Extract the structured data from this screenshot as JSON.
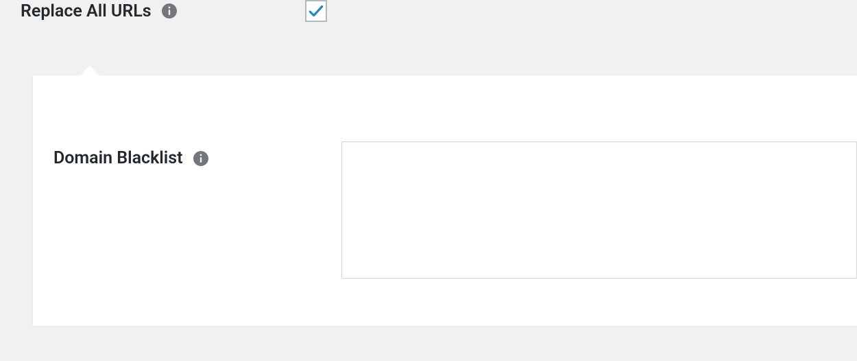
{
  "top": {
    "replace_all_urls_label": "Replace All URLs"
  },
  "panel": {
    "domain_blacklist_label": "Domain Blacklist",
    "domain_blacklist_value": ""
  },
  "icons": {
    "info_name": "info-icon"
  }
}
